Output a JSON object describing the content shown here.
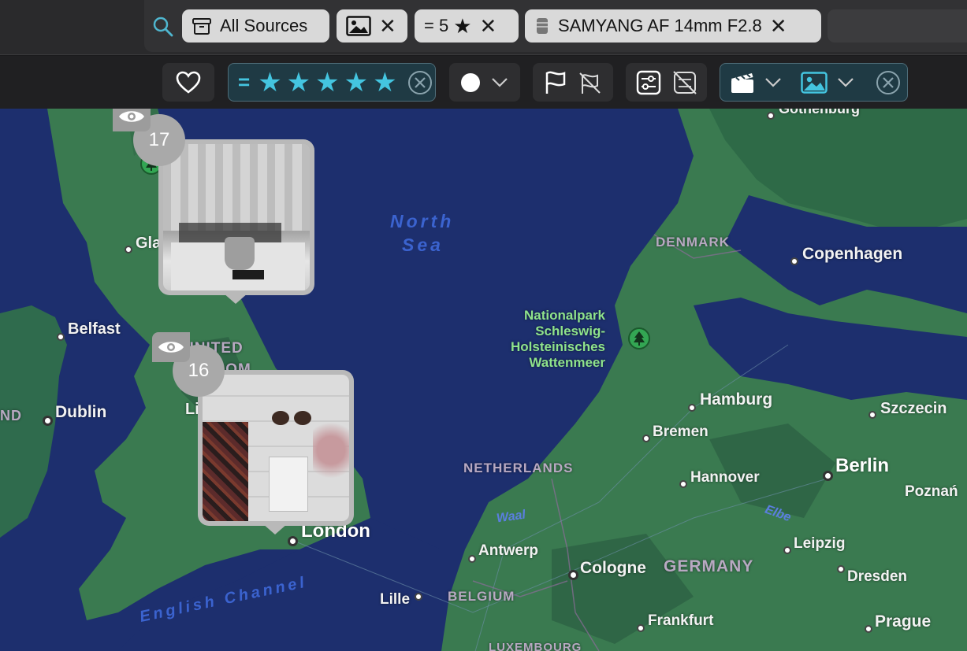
{
  "search": {
    "tokens": {
      "sources": "All Sources",
      "rating": "= 5",
      "lens": "SAMYANG AF 14mm F2.8"
    }
  },
  "filters": {
    "rating_prefix": "=",
    "rating_stars": 5,
    "accent": "#44c5e0"
  },
  "map": {
    "seas": {
      "north_line1": "North",
      "north_line2": "Sea",
      "channel": "English Channel"
    },
    "countries": {
      "uk_line1": "UNITED",
      "uk_line2": "KINGDOM",
      "denmark": "DENMARK",
      "netherlands": "NETHERLANDS",
      "germany": "GERMANY",
      "belgium": "BELGIUM",
      "luxembourg": "LUXEMBOURG",
      "ireland_partial": "ND"
    },
    "cities": {
      "gothenburg": "Gothenburg",
      "glasgow": "Gla",
      "copenhagen": "Copenhagen",
      "belfast": "Belfast",
      "dublin": "Dublin",
      "liverpool": "Li",
      "hamburg": "Hamburg",
      "szczecin": "Szczecin",
      "bremen": "Bremen",
      "berlin": "Berlin",
      "hannover": "Hannover",
      "poznan": "Poznań",
      "london": "London",
      "antwerp": "Antwerp",
      "cologne": "Cologne",
      "leipzig": "Leipzig",
      "dresden": "Dresden",
      "lille": "Lille",
      "frankfurt": "Frankfurt",
      "prague": "Prague"
    },
    "rivers": {
      "waal": "Waal",
      "elbe": "Elbe"
    },
    "park": {
      "line1": "Nationalpark",
      "line2": "Schleswig-",
      "line3": "Holsteinisches",
      "line4": "Wattenmeer"
    },
    "clusters": [
      {
        "count": "17"
      },
      {
        "count": "16"
      }
    ]
  }
}
